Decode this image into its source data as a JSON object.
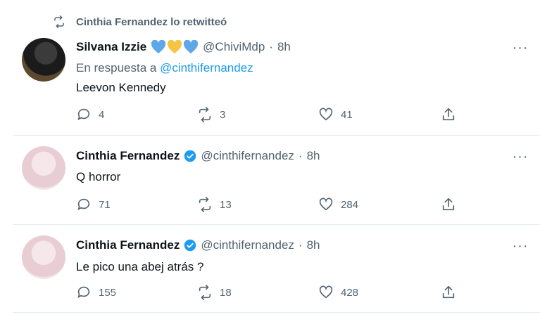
{
  "retweet": {
    "text": "Cinthia Fernandez lo retwitteó",
    "icon": "retweet-icon"
  },
  "tweets": [
    {
      "name": "Silvana Izzie",
      "emoji": [
        "blue-heart-icon",
        "yellow-heart-icon",
        "blue-heart-icon"
      ],
      "handle": "@ChiviMdp",
      "separator": "·",
      "time": "8h",
      "reply_prefix": "En respuesta a",
      "reply_mention": "@cinthifernandez",
      "text": "Leevon Kennedy",
      "replies": "4",
      "retweets": "3",
      "likes": "41"
    },
    {
      "name": "Cinthia Fernandez",
      "verified": true,
      "handle": "@cinthifernandez",
      "separator": "·",
      "time": "8h",
      "text": "Q horror",
      "replies": "71",
      "retweets": "13",
      "likes": "284"
    },
    {
      "name": "Cinthia Fernandez",
      "verified": true,
      "handle": "@cinthifernandez",
      "separator": "·",
      "time": "8h",
      "text": "Le pico una abej atrás ?",
      "replies": "155",
      "retweets": "18",
      "likes": "428"
    }
  ],
  "more_label": "···",
  "colors": {
    "accent": "#1d9bf0",
    "muted": "#536471",
    "heart_blue": "#5ea8e8",
    "heart_yellow": "#f5c542"
  }
}
